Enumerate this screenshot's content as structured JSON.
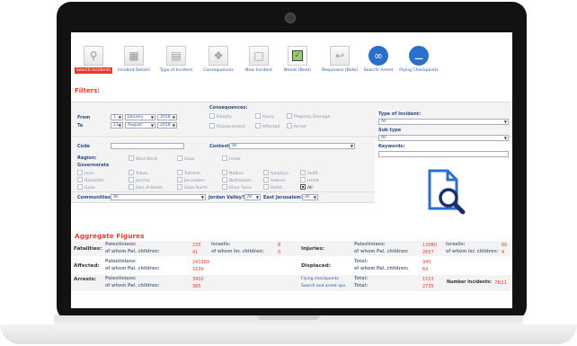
{
  "nav": [
    {
      "label": "Search Incidents",
      "icon": "search-icon",
      "active": true
    },
    {
      "label": "Incident Details",
      "icon": "table-icon"
    },
    {
      "label": "Type of Incident",
      "icon": "document-list-icon"
    },
    {
      "label": "Consequences",
      "icon": "people-icon"
    },
    {
      "label": "New Incident",
      "icon": "new-document-icon"
    },
    {
      "label": "Needs (Beta)",
      "icon": "checkbox-icon"
    },
    {
      "label": "Responses (Beta)",
      "icon": "response-icon"
    },
    {
      "label": "Search/ Arrest",
      "icon": "handcuffs-icon"
    },
    {
      "label": "Flying Checkpoints",
      "icon": "checkpoint-icon"
    }
  ],
  "filters": {
    "title": "Filters:",
    "from_label": "From",
    "to_label": "To",
    "from": {
      "day": "1",
      "month": "January",
      "year": "2018"
    },
    "to": {
      "day": "13",
      "month": "August",
      "year": "2018"
    },
    "consequences_label": "Consequences:",
    "consequences": [
      "Fatality",
      "Injury",
      "Property Damage",
      "Displacement",
      "Affected",
      "Arrest"
    ],
    "type_label": "Type of Incident:",
    "type_value": "All",
    "subtype_label": "Sub type",
    "subtype_value": "All",
    "keywords_label": "Keywords:",
    "code_label": "Code",
    "context_label": "Context:",
    "context_value": "All",
    "region_label": "Region:",
    "regions": [
      "West Bank",
      "Gaza",
      "Israel"
    ],
    "governorate_label": "Governorate",
    "governorates": [
      "Jenin",
      "Tubas",
      "Tulkarm",
      "Nablus",
      "Qalqiliya",
      "Salfit",
      "Ramallah",
      "Jericho",
      "Jerusalem",
      "Bethlehem",
      "Hebron",
      "Israel",
      "Gaza",
      "Deir Al-Balah",
      "Gaza North",
      "Khan Yunis",
      "Rafah",
      "All"
    ],
    "communities_label": "Communities",
    "communities_value": "All",
    "jordan_label": "Jordan Valley?",
    "jordan_value": "All",
    "ej_label": "East Jerusalem?",
    "ej_value": "All"
  },
  "aggregate": {
    "title": "Aggregate Figures",
    "fatalities": {
      "label": "Fatalities:",
      "pal_label": "Palestinians:",
      "pal": "235",
      "isr_label": "Israelis:",
      "isr": "8",
      "palc_label": "of whom Pal. children:",
      "palc": "41",
      "isrc_label": "of whom Isr. children:",
      "isrc": "0"
    },
    "injuries": {
      "label": "Injuries:",
      "pal_label": "Palestinians:",
      "pal": "13080",
      "isr_label": "Israelis:",
      "isr": "60",
      "palc_label": "of whom Pal. children:",
      "palc": "2657",
      "isrc_label": "of whom Isr. children:",
      "isrc": "4"
    },
    "affected": {
      "label": "Affected:",
      "pal_label": "Palestinians:",
      "pal": "241369",
      "palc_label": "of whom Pal. children:",
      "palc": "1639"
    },
    "displaced": {
      "label": "Displaced:",
      "total_label": "Total:",
      "total": "340",
      "palc_label": "of whom Pal. children:",
      "palc": "64"
    },
    "arrests": {
      "label": "Arrests:",
      "pal_label": "Palestinians:",
      "pal": "3902",
      "palc_label": "of whom Pal. children:",
      "palc": "385"
    },
    "flying": {
      "label": "Flying checkpoints",
      "total_label": "Total:",
      "total": "1553"
    },
    "search": {
      "label": "Search and arrest ops.",
      "total_label": "Total:",
      "total": "2735"
    },
    "incidents": {
      "label": "Number Incidents:",
      "value": "7821"
    }
  }
}
